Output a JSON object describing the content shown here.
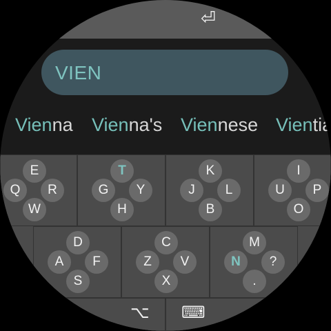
{
  "enter_icon": "enter-return-icon",
  "input": {
    "value": "VIEN"
  },
  "suggestions": [
    {
      "prefix": "Vien",
      "rest": "na"
    },
    {
      "prefix": "Vien",
      "rest": "na's"
    },
    {
      "prefix": "Vien",
      "rest": "nese"
    },
    {
      "prefix": "Vien",
      "rest": "tia"
    }
  ],
  "keys": {
    "k1": {
      "top": "E",
      "left": "Q",
      "right": "R",
      "bottom": "W"
    },
    "k2": {
      "top": "T",
      "left": "G",
      "right": "Y",
      "bottom": "H"
    },
    "k3": {
      "top": "K",
      "left": "J",
      "right": "L",
      "bottom": "B"
    },
    "k4": {
      "top": "I",
      "left": "U",
      "right": "P",
      "bottom": "O"
    },
    "k5": {
      "top": "D",
      "left": "A",
      "right": "F",
      "bottom": "S"
    },
    "k6": {
      "top": "C",
      "left": "Z",
      "right": "V",
      "bottom": "X"
    },
    "k7": {
      "top": "M",
      "left": "N",
      "right": "?",
      "bottom": "."
    }
  },
  "highlight_color": "#7fc4c0",
  "bottom_icons": {
    "alt": "option-key-icon",
    "keyboard": "keyboard-icon"
  }
}
